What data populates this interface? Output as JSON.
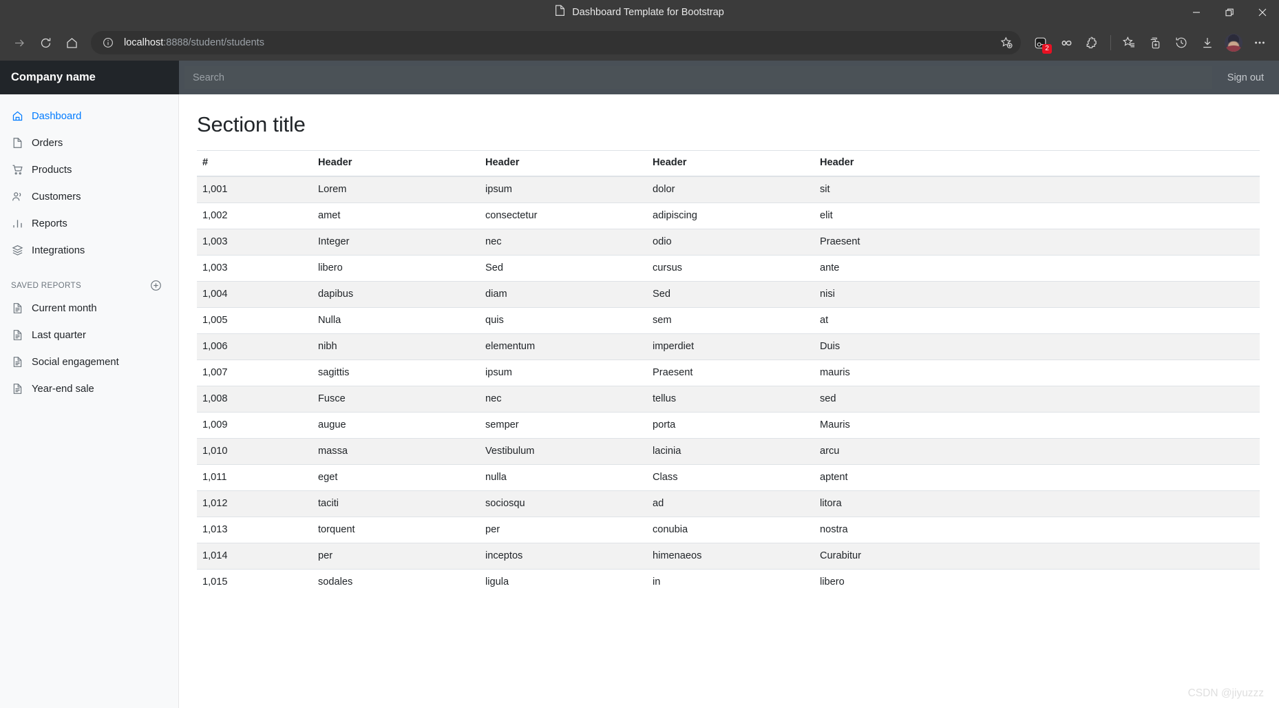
{
  "window": {
    "title": "Dashboard Template for Bootstrap",
    "title_icon": "page-icon",
    "minimize_label": "—",
    "restore_label": "restore-icon",
    "close_label": "✕"
  },
  "toolbar": {
    "forward_icon": "forward-arrow-icon",
    "reload_icon": "reload-icon",
    "home_icon": "home-icon",
    "site_info_icon": "info-icon",
    "url_host": "localhost",
    "url_rest": ":8888/student/students",
    "url_full": "localhost:8888/student/students",
    "add_favorite_icon": "star-plus-icon",
    "split_screen_icon": "split-screen-icon",
    "split_screen_badge": "2",
    "infinity_icon": "infinity-icon",
    "extensions_icon": "extensions-puzzle-icon",
    "favorites_icon": "favorites-star-list-icon",
    "collections_icon": "collections-add-icon",
    "history_icon": "history-clock-icon",
    "downloads_icon": "downloads-arrow-icon",
    "profile_icon": "profile-avatar",
    "more_icon": "more-ellipsis-icon"
  },
  "topnav": {
    "brand": "Company name",
    "search_value": "",
    "search_placeholder": "Search",
    "signout_label": "Sign out"
  },
  "sidebar": {
    "items": [
      {
        "label": "Dashboard",
        "icon": "home-icon",
        "active": true
      },
      {
        "label": "Orders",
        "icon": "file-icon",
        "active": false
      },
      {
        "label": "Products",
        "icon": "cart-icon",
        "active": false
      },
      {
        "label": "Customers",
        "icon": "users-icon",
        "active": false
      },
      {
        "label": "Reports",
        "icon": "bar-chart-icon",
        "active": false
      },
      {
        "label": "Integrations",
        "icon": "layers-icon",
        "active": false
      }
    ],
    "saved_reports_header": "Saved reports",
    "add_report_icon": "plus-circle-icon",
    "saved_reports": [
      {
        "label": "Current month",
        "icon": "file-text-icon"
      },
      {
        "label": "Last quarter",
        "icon": "file-text-icon"
      },
      {
        "label": "Social engagement",
        "icon": "file-text-icon"
      },
      {
        "label": "Year-end sale",
        "icon": "file-text-icon"
      }
    ]
  },
  "main": {
    "page_title": "Section title",
    "table": {
      "columns": [
        "#",
        "Header",
        "Header",
        "Header",
        "Header"
      ],
      "rows": [
        [
          "1,001",
          "Lorem",
          "ipsum",
          "dolor",
          "sit"
        ],
        [
          "1,002",
          "amet",
          "consectetur",
          "adipiscing",
          "elit"
        ],
        [
          "1,003",
          "Integer",
          "nec",
          "odio",
          "Praesent"
        ],
        [
          "1,003",
          "libero",
          "Sed",
          "cursus",
          "ante"
        ],
        [
          "1,004",
          "dapibus",
          "diam",
          "Sed",
          "nisi"
        ],
        [
          "1,005",
          "Nulla",
          "quis",
          "sem",
          "at"
        ],
        [
          "1,006",
          "nibh",
          "elementum",
          "imperdiet",
          "Duis"
        ],
        [
          "1,007",
          "sagittis",
          "ipsum",
          "Praesent",
          "mauris"
        ],
        [
          "1,008",
          "Fusce",
          "nec",
          "tellus",
          "sed"
        ],
        [
          "1,009",
          "augue",
          "semper",
          "porta",
          "Mauris"
        ],
        [
          "1,010",
          "massa",
          "Vestibulum",
          "lacinia",
          "arcu"
        ],
        [
          "1,011",
          "eget",
          "nulla",
          "Class",
          "aptent"
        ],
        [
          "1,012",
          "taciti",
          "sociosqu",
          "ad",
          "litora"
        ],
        [
          "1,013",
          "torquent",
          "per",
          "conubia",
          "nostra"
        ],
        [
          "1,014",
          "per",
          "inceptos",
          "himenaeos",
          "Curabitur"
        ],
        [
          "1,015",
          "sodales",
          "ligula",
          "in",
          "libero"
        ]
      ]
    }
  },
  "watermark": "CSDN @jiyuzzz",
  "colors": {
    "accent": "#007bff",
    "brand_bg": "#212529",
    "navbar_bg": "#495057",
    "sidebar_bg": "#f8f9fa",
    "chrome_bg": "#3b3b3b",
    "badge_red": "#e81123",
    "stripe": "#f2f2f2"
  }
}
